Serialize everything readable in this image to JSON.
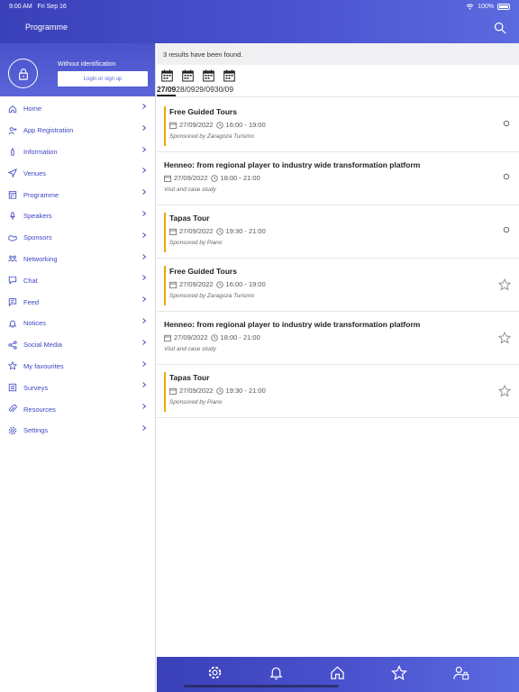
{
  "status": {
    "time": "9:00 AM",
    "date": "Fri Sep 16",
    "battery": "100%"
  },
  "header": {
    "title": "Programme"
  },
  "sidebar": {
    "noid_label": "Without identification",
    "login_label": "Login or sign up",
    "items": [
      {
        "label": "Home",
        "icon": "home-icon"
      },
      {
        "label": "App Registration",
        "icon": "user-plus-icon"
      },
      {
        "label": "Information",
        "icon": "info-icon"
      },
      {
        "label": "Venues",
        "icon": "location-arrow-icon"
      },
      {
        "label": "Programme",
        "icon": "calendar-icon"
      },
      {
        "label": "Speakers",
        "icon": "microphone-icon"
      },
      {
        "label": "Sponsors",
        "icon": "handshake-icon"
      },
      {
        "label": "Networking",
        "icon": "people-icon"
      },
      {
        "label": "Chat",
        "icon": "chat-icon"
      },
      {
        "label": "Feed",
        "icon": "feed-icon"
      },
      {
        "label": "Notices",
        "icon": "bell-icon"
      },
      {
        "label": "Social Media",
        "icon": "share-icon"
      },
      {
        "label": "My favourites",
        "icon": "star-icon"
      },
      {
        "label": "Surveys",
        "icon": "survey-icon"
      },
      {
        "label": "Resources",
        "icon": "paperclip-icon"
      },
      {
        "label": "Settings",
        "icon": "gear-icon"
      }
    ]
  },
  "main": {
    "results_text": "3 results have been found.",
    "dates": [
      "27/09",
      "28/09",
      "29/09",
      "30/09"
    ],
    "active_date": "27/09",
    "sessions": [
      {
        "title": "Free Guided Tours",
        "date": "27/09/2022",
        "time": "16:00 - 19:00",
        "sub": "Sponsored by Zaragoza Turismo",
        "accent": true,
        "fav": "dot"
      },
      {
        "title": "Henneo: from regional player to industry wide transformation platform",
        "date": "27/09/2022",
        "time": "18:00 - 21:00",
        "sub": "Visit and case study",
        "accent": false,
        "fav": "dot"
      },
      {
        "title": "Tapas Tour",
        "date": "27/09/2022",
        "time": "19:30 - 21:00",
        "sub": "Sponsored by Piano",
        "accent": true,
        "fav": "dot"
      },
      {
        "title": "Free Guided Tours",
        "date": "27/09/2022",
        "time": "16:00 - 19:00",
        "sub": "Sponsored by Zaragoza Turismo",
        "accent": true,
        "fav": "star"
      },
      {
        "title": "Henneo: from regional player to industry wide transformation platform",
        "date": "27/09/2022",
        "time": "18:00 - 21:00",
        "sub": "Visit and case study",
        "accent": false,
        "fav": "star"
      },
      {
        "title": "Tapas Tour",
        "date": "27/09/2022",
        "time": "19:30 - 21:00",
        "sub": "Sponsored by Piano",
        "accent": true,
        "fav": "star"
      }
    ]
  },
  "bottom_nav": [
    "gear-icon",
    "bell-icon",
    "home-icon",
    "star-icon",
    "user-lock-icon"
  ],
  "colors": {
    "brand": "#4b52cf",
    "accent_bar": "#f0a500",
    "menu_text": "#3d47c4"
  }
}
